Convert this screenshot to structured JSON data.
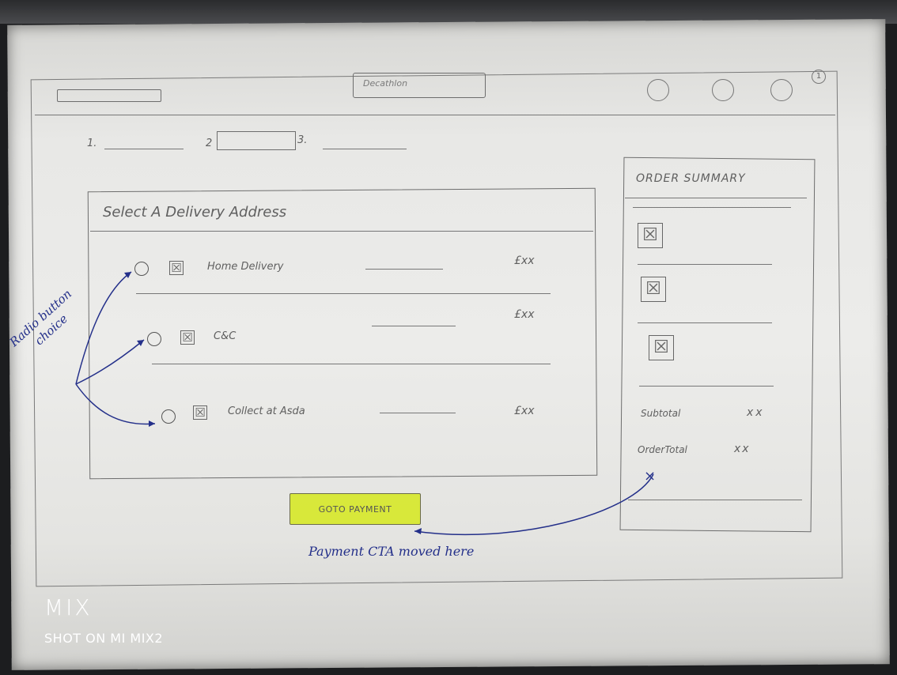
{
  "header": {
    "site_title": "Decathlon",
    "badge_number": "1"
  },
  "steps": {
    "step1": "1.",
    "step2": "2",
    "step3": "3."
  },
  "delivery": {
    "heading": "Select A Delivery Address",
    "options": [
      {
        "label": "Home Delivery",
        "price": "£xx"
      },
      {
        "label": "C&C",
        "price": "£xx"
      },
      {
        "label": "Collect at Asda",
        "price": "£xx"
      }
    ],
    "box_glyph": "☒"
  },
  "cta": {
    "label": "GOTO PAYMENT"
  },
  "summary": {
    "heading": "ORDER SUMMARY",
    "item_glyph": "☒",
    "subtotal_label": "Subtotal",
    "subtotal_value": "xx",
    "ordertotal_label": "OrderTotal",
    "ordertotal_value": "xx",
    "extra_mark": "×"
  },
  "annotations": {
    "radio_note_line1": "Radio button",
    "radio_note_line2": "choice",
    "cta_note": "Payment CTA moved here"
  },
  "watermark": {
    "brand": "MIX",
    "caption": "SHOT ON MI MIX2"
  },
  "colors": {
    "highlight": "#d6e828",
    "ink_blue": "#24308a",
    "pencil": "#6d6d6d"
  }
}
